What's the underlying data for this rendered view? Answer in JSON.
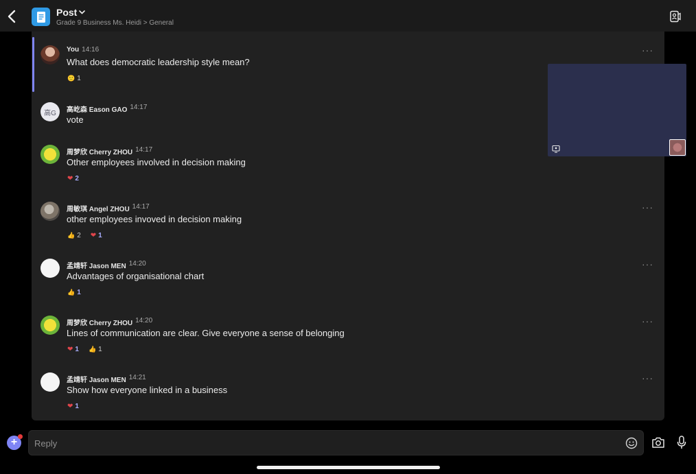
{
  "header": {
    "title": "Post",
    "subtitle": "Grade 9 Business Ms. Heidi > General"
  },
  "messages": [
    {
      "author": "You",
      "time": "14:16",
      "text": "What does democratic leadership style mean?",
      "avatar": "you",
      "reactions": [
        {
          "emoji": "🙂",
          "count": "1",
          "mine": false
        }
      ]
    },
    {
      "author": "高屹森 Eason GAO",
      "time": "14:17",
      "text": "vote",
      "avatar": "initial",
      "initials": "高G",
      "reactions": []
    },
    {
      "author": "周梦欣 Cherry ZHOU",
      "time": "14:17",
      "text": "Other employees involved in decision making",
      "avatar": "sponge",
      "reactions": [
        {
          "emoji": "❤",
          "count": "2",
          "mine": true
        }
      ]
    },
    {
      "author": "周敏琪 Angel ZHOU",
      "time": "14:17",
      "text": "other employees invoved in decision making",
      "avatar": "photo",
      "reactions": [
        {
          "emoji": "👍",
          "count": "2",
          "mine": false
        },
        {
          "emoji": "❤",
          "count": "1",
          "mine": true
        }
      ]
    },
    {
      "author": "孟靖轩 Jason MEN",
      "time": "14:20",
      "text": "Advantages of organisational chart",
      "avatar": "blank",
      "reactions": [
        {
          "emoji": "👍",
          "count": "1",
          "mine": true
        }
      ]
    },
    {
      "author": "周梦欣 Cherry ZHOU",
      "time": "14:20",
      "text": "Lines of communication are clear. Give everyone a sense of belonging",
      "avatar": "sponge",
      "reactions": [
        {
          "emoji": "❤",
          "count": "1",
          "mine": true
        },
        {
          "emoji": "👍",
          "count": "1",
          "mine": false
        }
      ]
    },
    {
      "author": "孟靖轩 Jason MEN",
      "time": "14:21",
      "text": "Show how everyone linked in a business",
      "avatar": "blank",
      "reactions": [
        {
          "emoji": "❤",
          "count": "1",
          "mine": true
        }
      ]
    }
  ],
  "compose": {
    "placeholder": "Reply"
  },
  "colors": {
    "accent": "#7f85f5",
    "heart": "#e0454b",
    "background": "#000000",
    "panel": "#212121"
  }
}
